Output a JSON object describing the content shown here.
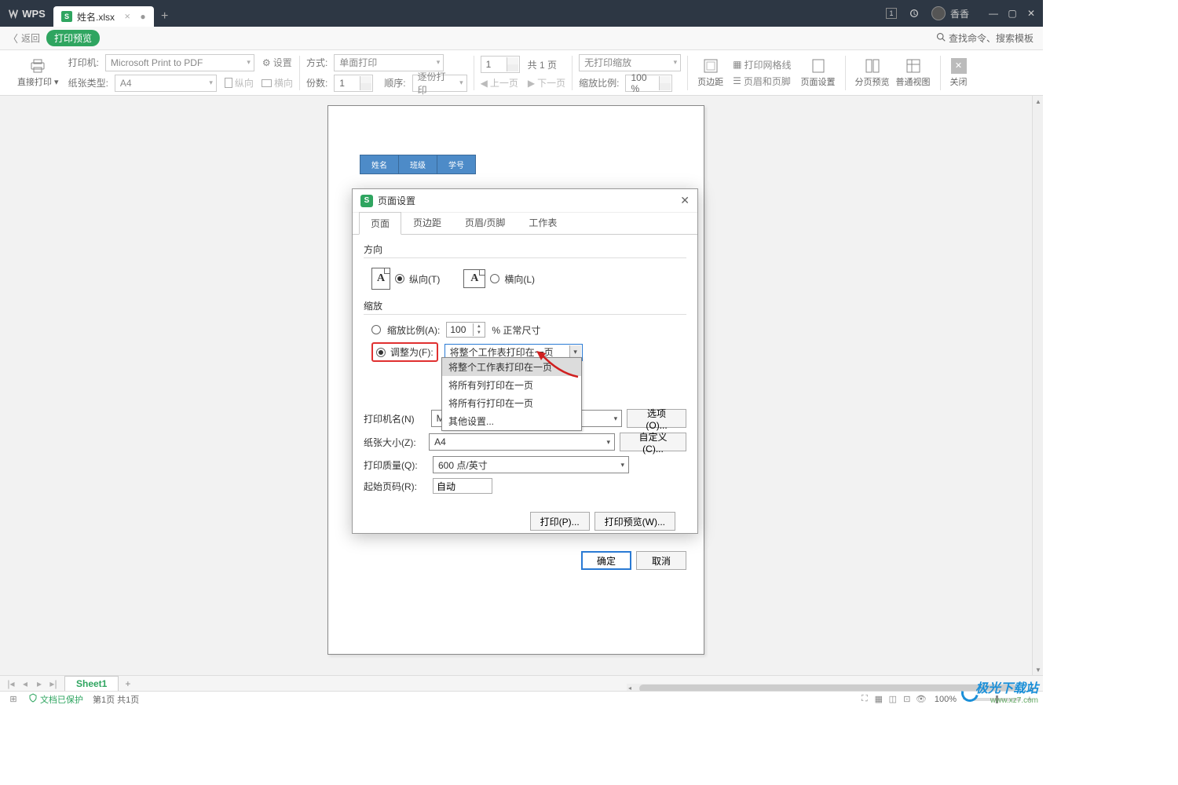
{
  "titlebar": {
    "app_name": "WPS",
    "tab_filename": "姓名.xlsx",
    "tab_modified_marker": "●",
    "user_name": "香香"
  },
  "breadcrumb": {
    "return_label": "返回",
    "badge_label": "打印预览",
    "search_placeholder": "查找命令、搜索模板"
  },
  "toolbar": {
    "direct_print": "直接打印",
    "printer_label": "打印机:",
    "printer_value": "Microsoft Print to PDF",
    "settings_label": "设置",
    "paper_type_label": "纸张类型:",
    "paper_type_value": "A4",
    "portrait_label": "纵向",
    "landscape_label": "横向",
    "mode_label": "方式:",
    "mode_value": "单面打印",
    "copies_label": "份数:",
    "copies_value": "1",
    "order_label": "顺序:",
    "order_value": "逐份打印",
    "page_current": "1",
    "page_total": "共 1 页",
    "prev_page": "上一页",
    "next_page": "下一页",
    "scale_mode_value": "无打印缩放",
    "scale_ratio_label": "缩放比例:",
    "scale_ratio_value": "100 %",
    "margins": "页边距",
    "header_footer": "页眉和页脚",
    "gridlines": "打印网格线",
    "page_setup": "页面设置",
    "page_break": "分页预览",
    "normal_view": "普通视图",
    "close": "关闭"
  },
  "preview": {
    "headers": [
      "姓名",
      "班级",
      "学号"
    ]
  },
  "dialog": {
    "title": "页面设置",
    "tabs": [
      "页面",
      "页边距",
      "页眉/页脚",
      "工作表"
    ],
    "orientation": {
      "label": "方向",
      "portrait": "纵向(T)",
      "landscape": "横向(L)"
    },
    "scaling": {
      "label": "缩放",
      "ratio_label": "缩放比例(A):",
      "ratio_value": "100",
      "ratio_suffix": "% 正常尺寸",
      "adjust_label": "调整为(F):",
      "adjust_value": "将整个工作表打印在一页",
      "options": [
        "将整个工作表打印在一页",
        "将所有列打印在一页",
        "将所有行打印在一页",
        "其他设置..."
      ]
    },
    "printer_name_label": "打印机名(N)",
    "printer_name_value": "Mic",
    "options_btn": "选项(O)...",
    "paper_size_label": "纸张大小(Z):",
    "paper_size_value": "A4",
    "custom_btn": "自定义(C)...",
    "print_quality_label": "打印质量(Q):",
    "print_quality_value": "600 点/英寸",
    "start_page_label": "起始页码(R):",
    "start_page_value": "自动",
    "print_btn": "打印(P)...",
    "preview_btn": "打印预览(W)...",
    "ok_btn": "确定",
    "cancel_btn": "取消"
  },
  "sheetbar": {
    "sheet_name": "Sheet1"
  },
  "statusbar": {
    "protected": "文档已保护",
    "page_info": "第1页 共1页",
    "zoom": "100%"
  },
  "watermark": {
    "main": "极光下载站",
    "sub": "www.xz7.com"
  }
}
